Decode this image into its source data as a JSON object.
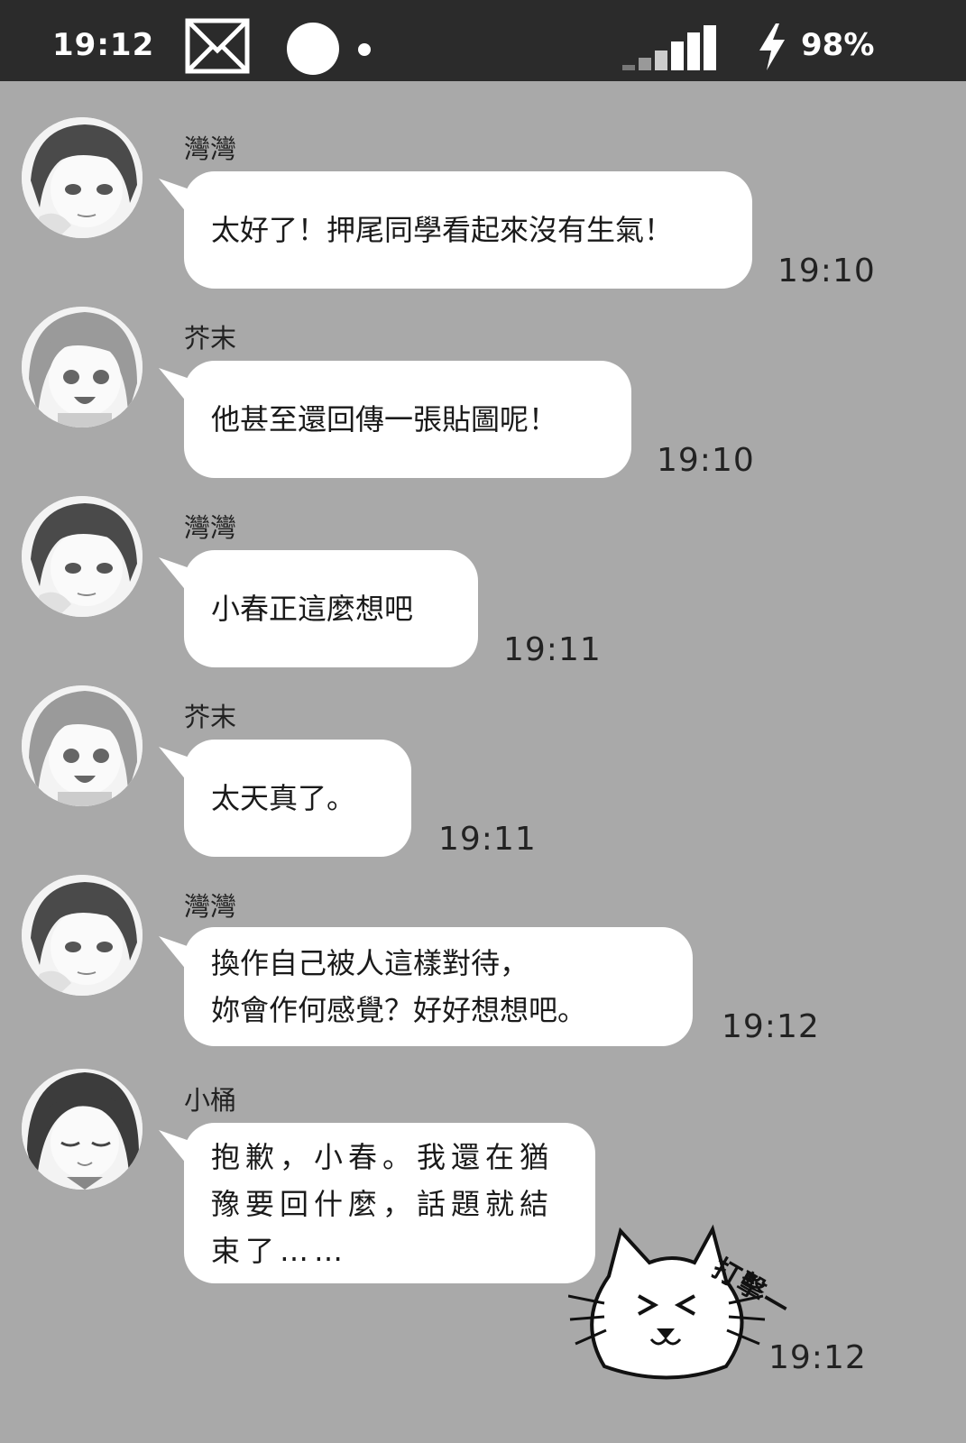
{
  "status_bar": {
    "time": "19:12",
    "battery": "98%",
    "icons": [
      "mail-icon",
      "circle-icon",
      "dot-icon",
      "signal-icon",
      "charging-bolt-icon"
    ]
  },
  "messages": [
    {
      "sender": "灣灣",
      "text": "太好了！押尾同學看起來沒有生氣！",
      "time": "19:10",
      "avatar": "girl-short-hair-avatar"
    },
    {
      "sender": "芥末",
      "text": "他甚至還回傳一張貼圖呢！",
      "time": "19:10",
      "avatar": "girl-smiling-avatar"
    },
    {
      "sender": "灣灣",
      "text": "小春正這麼想吧",
      "time": "19:11",
      "avatar": "girl-short-hair-avatar"
    },
    {
      "sender": "芥末",
      "text": "太天真了。",
      "time": "19:11",
      "avatar": "girl-smiling-avatar"
    },
    {
      "sender": "灣灣",
      "text": "換作自己被人這樣對待，\n妳會作何感覺？好好想想吧。",
      "time": "19:12",
      "avatar": "girl-short-hair-avatar"
    },
    {
      "sender": "小桶",
      "text": "抱歉，小春。我還在猶\n豫要回什麼，話題就結\n束了……",
      "time": "19:12",
      "avatar": "girl-eyes-closed-avatar"
    }
  ],
  "sticker": {
    "text": "打擊—",
    "time": "19:12",
    "icon": "cat-sticker-icon"
  }
}
